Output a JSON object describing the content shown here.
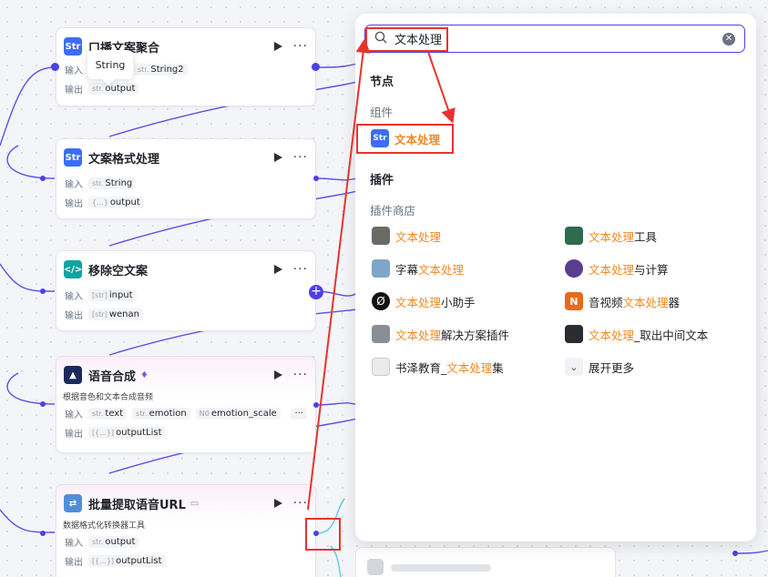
{
  "colors": {
    "accent": "#4e40e5",
    "highlight": "#f08a24",
    "annotation": "#e8332d"
  },
  "labels": {
    "input": "输入",
    "output": "输出"
  },
  "tooltip": "String",
  "nodes": [
    {
      "title": "口播文案聚合",
      "icon": "text-tool-icon",
      "inputs": [
        {
          "type": "str.",
          "name": "String2"
        }
      ],
      "outputs": [
        {
          "type": "str.",
          "name": "output"
        }
      ]
    },
    {
      "title": "文案格式处理",
      "icon": "text-tool-icon",
      "inputs": [
        {
          "type": "str.",
          "name": "String"
        }
      ],
      "outputs": [
        {
          "type": "{...}",
          "name": "output"
        }
      ]
    },
    {
      "title": "移除空文案",
      "icon": "code-icon",
      "inputs": [
        {
          "type": "[str]",
          "name": "input"
        }
      ],
      "outputs": [
        {
          "type": "[str]",
          "name": "wenan"
        }
      ]
    },
    {
      "title": "语音合成",
      "icon": "voice-synthesis-icon",
      "desc": "根据音色和文本合成音频",
      "inputs": [
        {
          "type": "str.",
          "name": "text"
        },
        {
          "type": "str.",
          "name": "emotion"
        },
        {
          "type": "N0",
          "name": "emotion_scale"
        }
      ],
      "outputs": [
        {
          "type": "[{...}]",
          "name": "outputList"
        }
      ]
    },
    {
      "title": "批量提取语音URL",
      "icon": "converter-icon",
      "desc": "数据格式化转换器工具",
      "inputs": [
        {
          "type": "str.",
          "name": "output"
        }
      ],
      "outputs": [
        {
          "type": "[{...}]",
          "name": "outputList"
        }
      ]
    }
  ],
  "search": {
    "query": "文本处理"
  },
  "sections": {
    "nodes": "节点",
    "components": "组件",
    "plugins": "插件",
    "plugin_store": "插件商店"
  },
  "component_item": {
    "hl": "文本处理",
    "rest": ""
  },
  "plugins": [
    {
      "pre": "",
      "hl": "文本处理",
      "post": "",
      "icon": "laptop-app-icon"
    },
    {
      "pre": "",
      "hl": "文本处理",
      "post": "工具",
      "icon": "app-thumbnail-icon"
    },
    {
      "pre": "字幕",
      "hl": "文本处理",
      "post": "",
      "icon": "avatar-app-icon"
    },
    {
      "pre": "",
      "hl": "文本处理",
      "post": "与计算",
      "icon": "calculator-app-icon"
    },
    {
      "pre": "",
      "hl": "文本处理",
      "post": "小助手",
      "icon": "assistant-app-icon"
    },
    {
      "pre": "音视频",
      "hl": "文本处理",
      "post": "器",
      "icon": "media-app-icon"
    },
    {
      "pre": "",
      "hl": "文本处理",
      "post": "解决方案插件",
      "icon": "solution-app-icon"
    },
    {
      "pre": "",
      "hl": "文本处理",
      "post": "_取出中间文本",
      "icon": "extract-app-icon"
    },
    {
      "pre": "书泽教育_",
      "hl": "文本处理",
      "post": "集",
      "icon": "education-app-icon"
    }
  ],
  "expand_more": "展开更多"
}
